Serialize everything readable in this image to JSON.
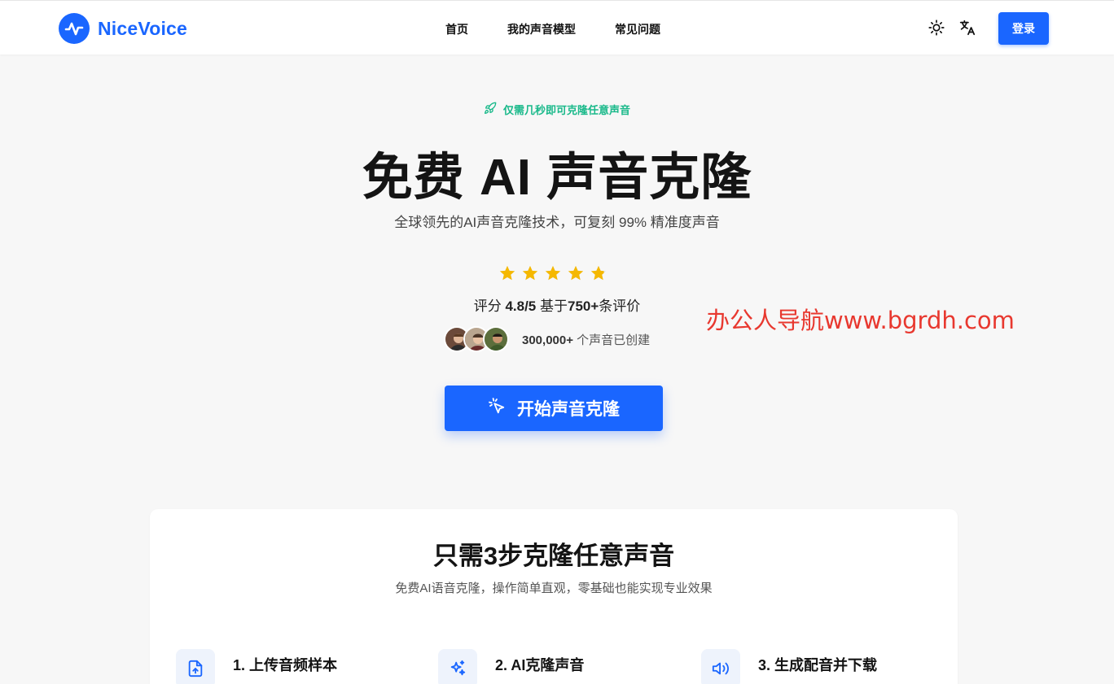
{
  "header": {
    "brand": "NiceVoice",
    "nav": [
      "首页",
      "我的声音模型",
      "常见问题"
    ],
    "login_label": "登录",
    "icons": {
      "theme": "sun-icon",
      "language": "translate-icon"
    }
  },
  "hero": {
    "tagline": "仅需几秒即可克隆任意声音",
    "title": "免费 AI 声音克隆",
    "subtitle": "全球领先的AI声音克隆技术，可复刻 99% 精准度声音",
    "stars": 4.8,
    "rating_prefix": "评分 ",
    "rating_value": "4.8/5",
    "rating_mid": " 基于",
    "rating_count": "750+",
    "rating_suffix": "条评价",
    "voices_count": "300,000+",
    "voices_text": " 个声音已创建",
    "cta_label": "开始声音克隆"
  },
  "watermark": "办公人导航www.bgrdh.com",
  "steps_section": {
    "title": "只需3步克隆任意声音",
    "subtitle": "免费AI语音克隆，操作简单直观，零基础也能实现专业效果",
    "steps": [
      {
        "label": "1. 上传音频样本",
        "icon": "file-upload-icon"
      },
      {
        "label": "2. AI克隆声音",
        "icon": "sparkles-icon"
      },
      {
        "label": "3. 生成配音并下载",
        "icon": "speaker-icon"
      }
    ]
  },
  "colors": {
    "accent": "#1a66ff",
    "tagline": "#19b98a",
    "star": "#f5b800",
    "watermark": "#e8382f"
  }
}
